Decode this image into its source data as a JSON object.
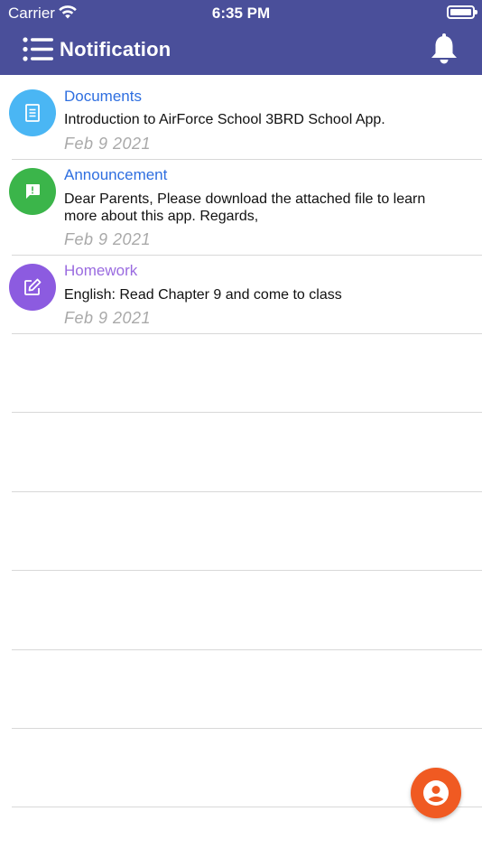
{
  "status_bar": {
    "carrier": "Carrier",
    "time": "6:35 PM"
  },
  "header": {
    "title": "Notification",
    "background_color": "#4a4f9a"
  },
  "notifications": [
    {
      "category": "Documents",
      "category_color": "#2f6fe0",
      "icon": "document-icon",
      "icon_bg": "#4ab6f4",
      "text": "Introduction to AirForce School 3BRD School App.",
      "date": "Feb  9 2021"
    },
    {
      "category": "Announcement",
      "category_color": "#2f6fe0",
      "icon": "announcement-icon",
      "icon_bg": "#3bb54a",
      "text": "Dear Parents, Please download the attached file to learn more about this app. Regards,",
      "date": "Feb  9 2021"
    },
    {
      "category": "Homework",
      "category_color": "#9a6be0",
      "icon": "edit-icon",
      "icon_bg": "#8c5be0",
      "text": "English: Read Chapter 9 and come to class",
      "date": "Feb  9 2021"
    }
  ],
  "fab": {
    "icon": "account-icon",
    "color": "#f05a22"
  }
}
